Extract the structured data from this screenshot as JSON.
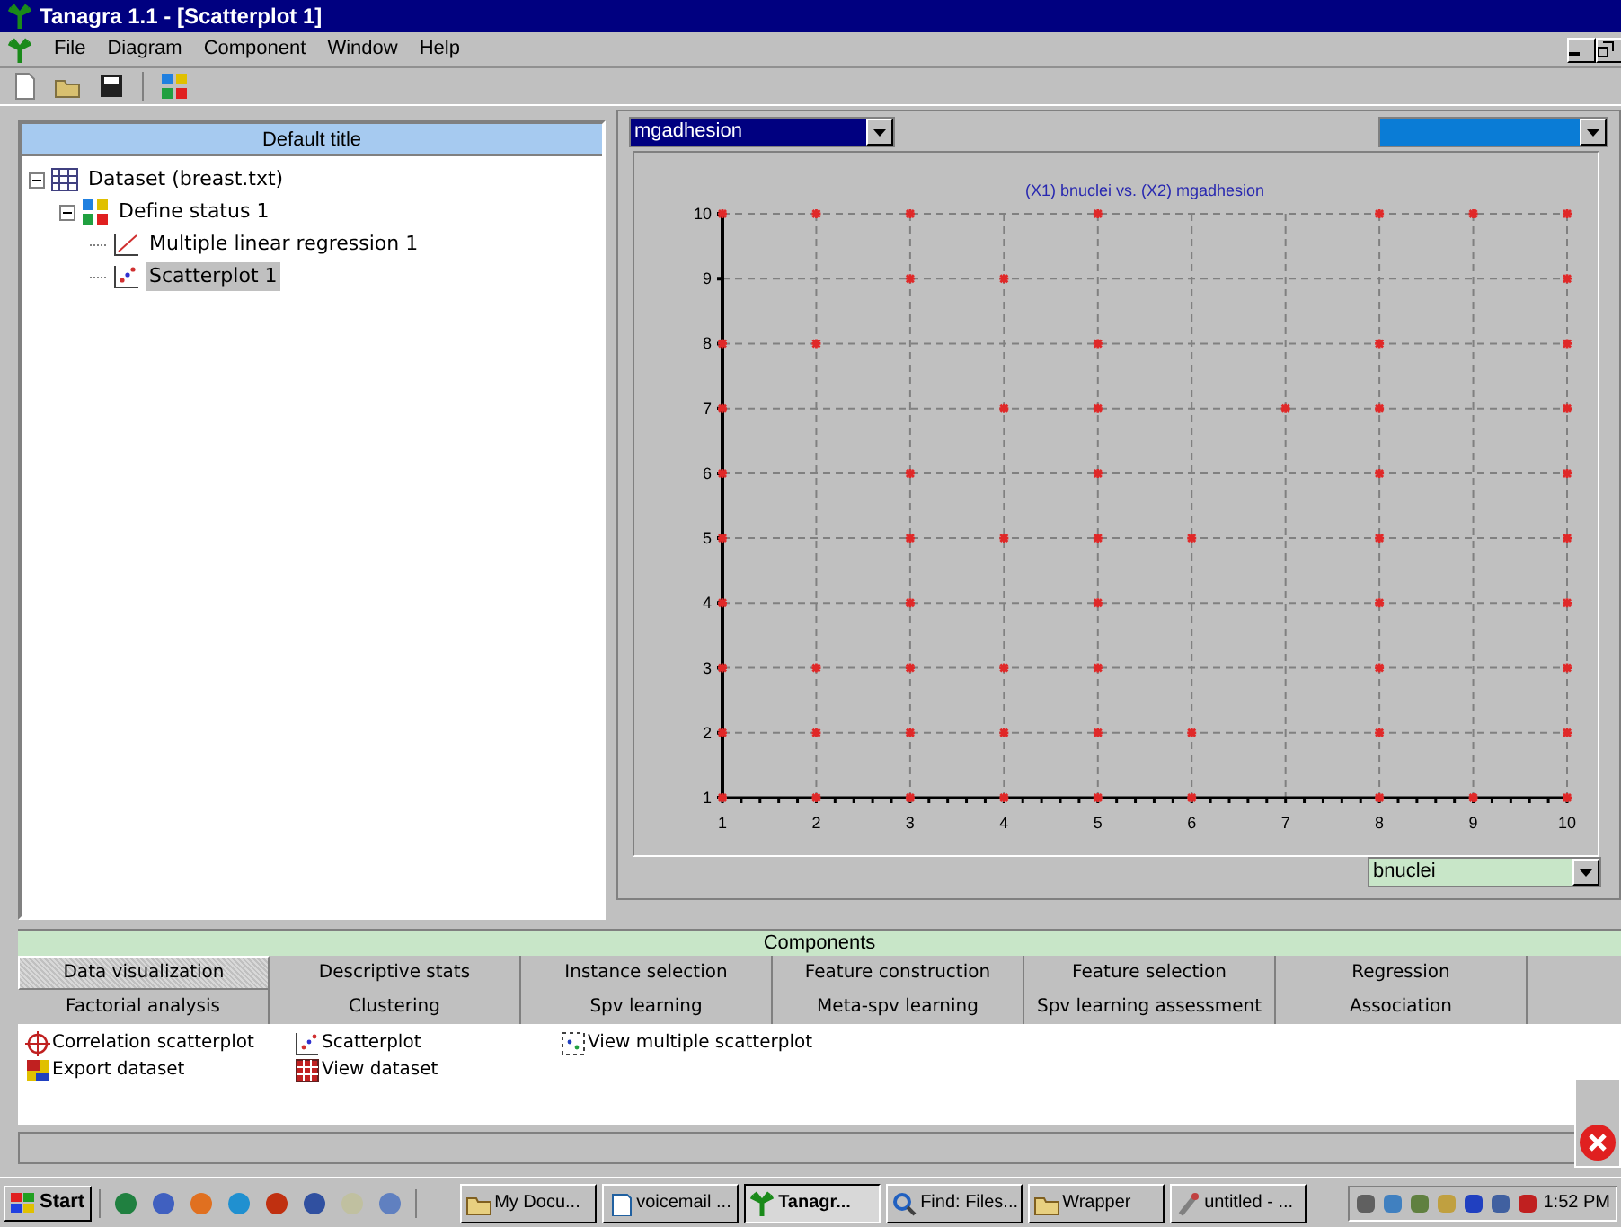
{
  "window": {
    "title": "Tanagra 1.1 - [Scatterplot 1]"
  },
  "menu": [
    "File",
    "Diagram",
    "Component",
    "Window",
    "Help"
  ],
  "toolbar": [
    {
      "kind": "new"
    },
    {
      "kind": "open"
    },
    {
      "kind": "save"
    },
    {
      "kind": "components"
    }
  ],
  "diagram": {
    "title": "Default title",
    "tree": [
      {
        "label": "Dataset (breast.txt)",
        "kind": "dataset",
        "selected": false,
        "expanded": true,
        "children": [
          {
            "label": "Define status 1",
            "kind": "status",
            "selected": false,
            "expanded": true,
            "children": [
              {
                "label": "Multiple linear regression 1",
                "kind": "regression",
                "selected": false
              },
              {
                "label": "Scatterplot 1",
                "kind": "scatter",
                "selected": true
              }
            ]
          }
        ]
      }
    ]
  },
  "view": {
    "y_attribute": "mgadhesion",
    "x_attribute": "bnuclei",
    "chart_data": {
      "type": "scatter",
      "grid": true,
      "title": "(X1) bnuclei vs. (X2) mgadhesion",
      "xlim": [
        1,
        10
      ],
      "ylim": [
        1,
        10
      ],
      "xticks": [
        1,
        2,
        3,
        4,
        5,
        6,
        7,
        8,
        9,
        10
      ],
      "yticks": [
        1,
        2,
        3,
        4,
        5,
        6,
        7,
        8,
        9,
        10
      ],
      "x": [
        1,
        2,
        3,
        5,
        8,
        9,
        10,
        3,
        4,
        10,
        1,
        2,
        5,
        8,
        10,
        1,
        4,
        5,
        7,
        8,
        10,
        1,
        3,
        5,
        8,
        10,
        1,
        3,
        4,
        5,
        6,
        8,
        10,
        1,
        3,
        5,
        8,
        10,
        1,
        2,
        3,
        4,
        5,
        8,
        10,
        1,
        2,
        3,
        4,
        5,
        6,
        8,
        10,
        1,
        2,
        3,
        4,
        5,
        6,
        8,
        9,
        10
      ],
      "series": [
        {
          "color": "#e02828",
          "values": [
            10,
            10,
            10,
            10,
            10,
            10,
            10,
            9,
            9,
            9,
            8,
            8,
            8,
            8,
            8,
            7,
            7,
            7,
            7,
            7,
            7,
            6,
            6,
            6,
            6,
            6,
            5,
            5,
            5,
            5,
            5,
            5,
            5,
            4,
            4,
            4,
            4,
            4,
            3,
            3,
            3,
            3,
            3,
            3,
            3,
            2,
            2,
            2,
            2,
            2,
            2,
            2,
            2,
            1,
            1,
            1,
            1,
            1,
            1,
            1,
            1,
            1
          ]
        }
      ]
    }
  },
  "components": {
    "title": "Components",
    "tabs": [
      {
        "label": "Data visualization",
        "selected": true
      },
      {
        "label": "Descriptive stats",
        "selected": false
      },
      {
        "label": "Instance selection",
        "selected": false
      },
      {
        "label": "Feature construction",
        "selected": false
      },
      {
        "label": "Feature selection",
        "selected": false
      },
      {
        "label": "Regression",
        "selected": false
      },
      {
        "label": "Factorial analysis",
        "selected": false
      },
      {
        "label": "Clustering",
        "selected": false
      },
      {
        "label": "Spv learning",
        "selected": false
      },
      {
        "label": "Meta-spv learning",
        "selected": false
      },
      {
        "label": "Spv learning assessment",
        "selected": false
      },
      {
        "label": "Association",
        "selected": false
      }
    ],
    "items": [
      {
        "label": "Correlation scatterplot",
        "kind": "crosshair"
      },
      {
        "label": "Scatterplot",
        "kind": "scatter"
      },
      {
        "label": "View multiple scatterplot",
        "kind": "multi"
      },
      {
        "label": "Export dataset",
        "kind": "export"
      },
      {
        "label": "View dataset",
        "kind": "view"
      }
    ]
  },
  "taskbar": {
    "start": "Start",
    "tasks": [
      {
        "label": "My Docu...",
        "kind": "folder",
        "selected": false
      },
      {
        "label": "voicemail ...",
        "kind": "doc",
        "selected": false
      },
      {
        "label": "Tanagr...",
        "kind": "palm",
        "selected": true
      },
      {
        "label": "Find: Files...",
        "kind": "find",
        "selected": false
      },
      {
        "label": "Wrapper",
        "kind": "folder",
        "selected": false
      },
      {
        "label": "untitled - ...",
        "kind": "paint",
        "selected": false
      }
    ],
    "clock": "1:52 PM"
  }
}
